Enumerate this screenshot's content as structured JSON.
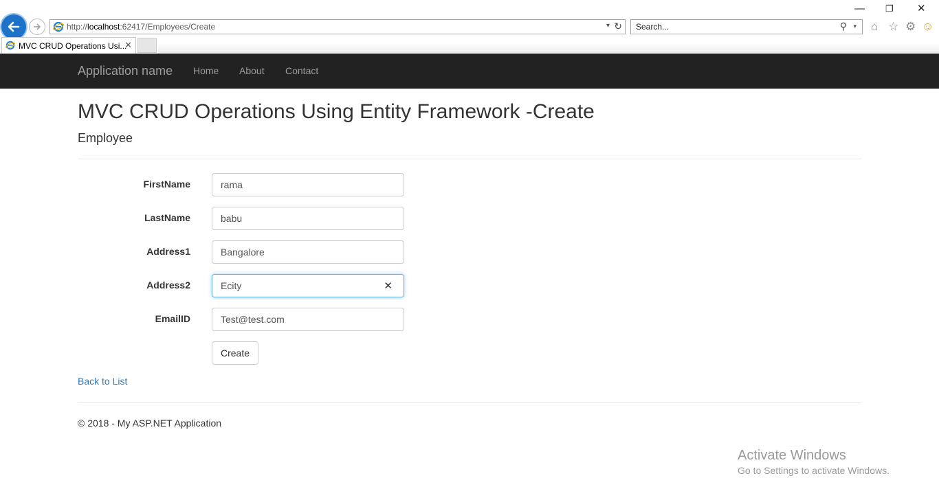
{
  "browser": {
    "url_prefix": "http://",
    "url_host": "localhost",
    "url_rest": ":62417/Employees/Create",
    "search_placeholder": "Search...",
    "tab_title": "MVC CRUD Operations Usi...",
    "tab_close": "✕",
    "refresh_icon": "↻",
    "search_icon": "⚲",
    "dropdown_icon": "▾",
    "home_icon": "⌂",
    "favorites_icon": "☆",
    "settings_icon": "⚙",
    "smiley_icon": "☺",
    "minimize": "—",
    "restore": "❐",
    "close": "✕"
  },
  "navbar": {
    "brand": "Application name",
    "links": [
      "Home",
      "About",
      "Contact"
    ]
  },
  "page": {
    "title": "MVC CRUD Operations Using Entity Framework -Create",
    "subtitle": "Employee"
  },
  "form": {
    "fields": [
      {
        "label": "FirstName",
        "value": "rama"
      },
      {
        "label": "LastName",
        "value": "babu"
      },
      {
        "label": "Address1",
        "value": "Bangalore"
      },
      {
        "label": "Address2",
        "value": "Ecity"
      },
      {
        "label": "EmailID",
        "value": "Test@test.com"
      }
    ],
    "clear_icon": "✕",
    "submit_label": "Create"
  },
  "back_link": "Back to List",
  "footer": "© 2018 - My ASP.NET Application",
  "watermark": {
    "line1": "Activate Windows",
    "line2": "Go to Settings to activate Windows."
  },
  "colors": {
    "navbar_bg": "#222222",
    "link": "#337ab7",
    "back_button": "#1e73c8",
    "focus_border": "#66afe9"
  }
}
